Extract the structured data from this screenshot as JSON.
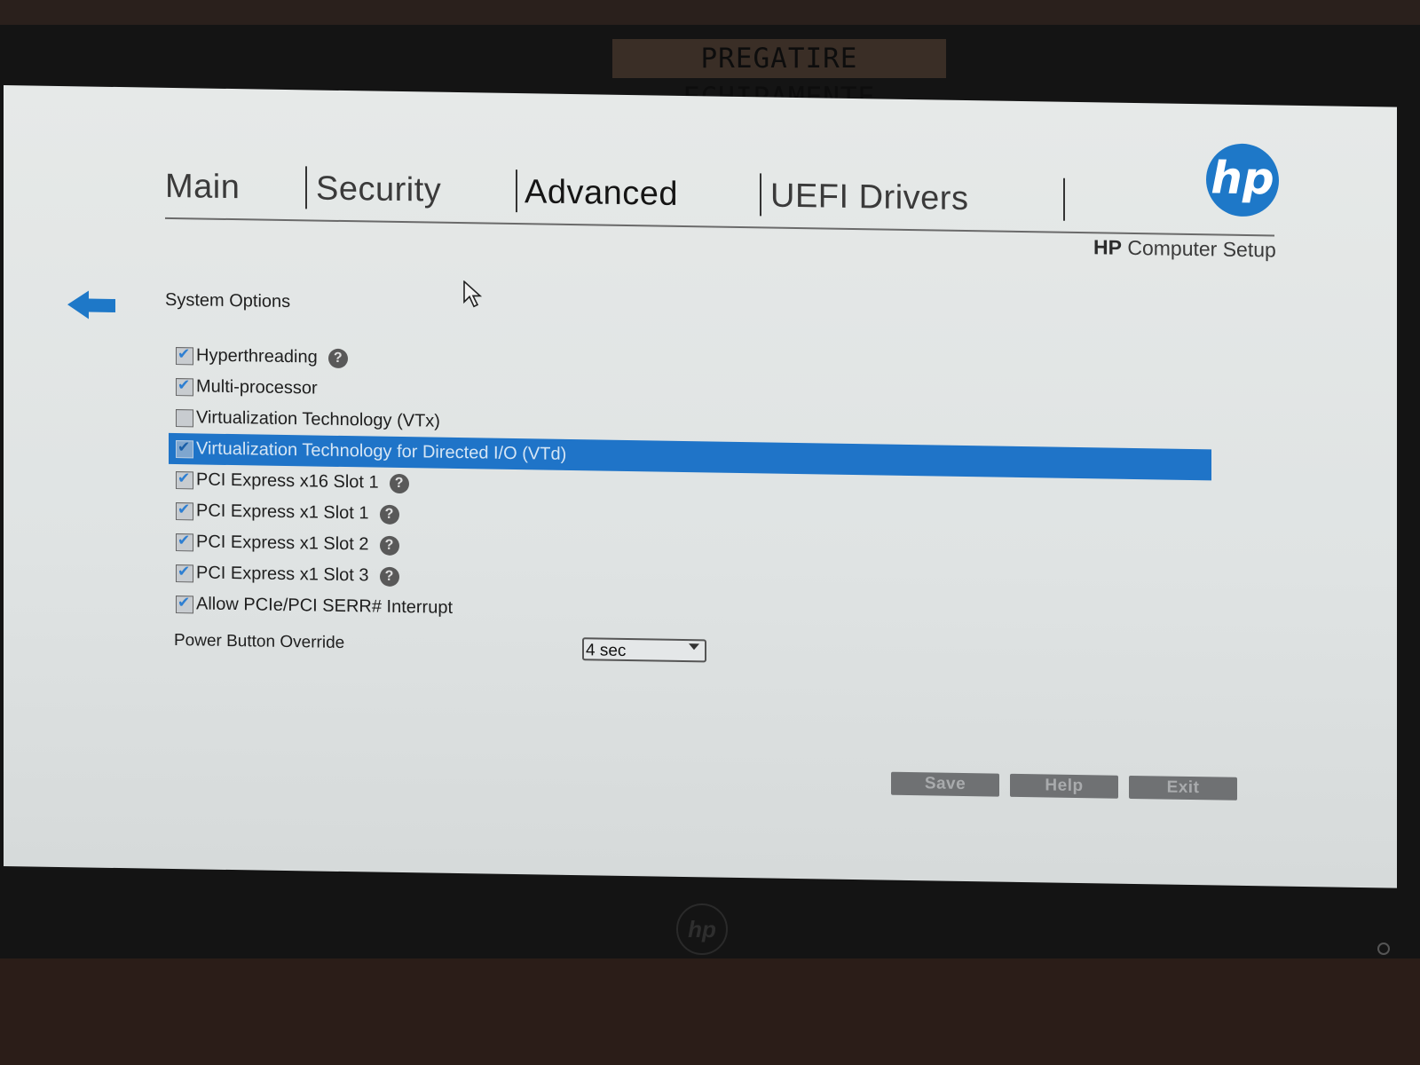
{
  "bezel": {
    "label": "PREGATIRE ECHIPAMENTE",
    "logo": "hp"
  },
  "header": {
    "tabs": [
      {
        "label": "Main",
        "active": false
      },
      {
        "label": "Security",
        "active": false
      },
      {
        "label": "Advanced",
        "active": true
      },
      {
        "label": "UEFI Drivers",
        "active": false
      }
    ],
    "logo_text": "hp",
    "setup_brand": "HP",
    "setup_title": "Computer Setup",
    "accent_color": "#1e78c8"
  },
  "section": {
    "back_icon": "arrow-left-icon",
    "title": "System Options"
  },
  "options": [
    {
      "label": "Hyperthreading",
      "checked": true,
      "help": true,
      "selected": false
    },
    {
      "label": "Multi-processor",
      "checked": true,
      "help": false,
      "selected": false
    },
    {
      "label": "Virtualization Technology (VTx)",
      "checked": false,
      "help": false,
      "selected": false
    },
    {
      "label": "Virtualization Technology for Directed I/O (VTd)",
      "checked": true,
      "help": false,
      "selected": true
    },
    {
      "label": "PCI Express x16 Slot 1",
      "checked": true,
      "help": true,
      "selected": false
    },
    {
      "label": "PCI Express x1 Slot 1",
      "checked": true,
      "help": true,
      "selected": false
    },
    {
      "label": "PCI Express x1 Slot 2",
      "checked": true,
      "help": true,
      "selected": false
    },
    {
      "label": "PCI Express x1 Slot 3",
      "checked": true,
      "help": true,
      "selected": false
    },
    {
      "label": "Allow PCIe/PCI SERR# Interrupt",
      "checked": true,
      "help": false,
      "selected": false
    }
  ],
  "help_glyph": "?",
  "power_button_override": {
    "label": "Power Button Override",
    "value": "4 sec"
  },
  "buttons": {
    "save": "Save",
    "help": "Help",
    "exit": "Exit"
  },
  "selection_color": "#1f74c8"
}
